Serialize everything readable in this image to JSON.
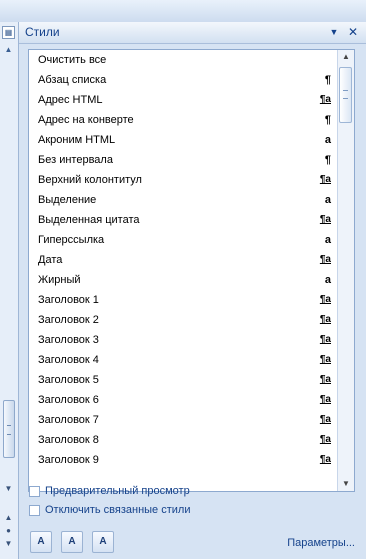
{
  "pane": {
    "title": "Стили",
    "dropdown_icon": "▼",
    "close_icon": "✕"
  },
  "styles": [
    {
      "name": "Очистить все",
      "glyph": "",
      "type": "none"
    },
    {
      "name": "Абзац списка",
      "glyph": "¶",
      "type": "paragraph"
    },
    {
      "name": "Адрес HTML",
      "glyph": "¶a",
      "type": "linked"
    },
    {
      "name": "Адрес на конверте",
      "glyph": "¶",
      "type": "paragraph"
    },
    {
      "name": "Акроним HTML",
      "glyph": "a",
      "type": "character"
    },
    {
      "name": "Без интервала",
      "glyph": "¶",
      "type": "paragraph"
    },
    {
      "name": "Верхний колонтитул",
      "glyph": "¶a",
      "type": "linked"
    },
    {
      "name": "Выделение",
      "glyph": "a",
      "type": "character"
    },
    {
      "name": "Выделенная цитата",
      "glyph": "¶a",
      "type": "linked"
    },
    {
      "name": "Гиперссылка",
      "glyph": "a",
      "type": "character"
    },
    {
      "name": "Дата",
      "glyph": "¶a",
      "type": "linked"
    },
    {
      "name": "Жирный",
      "glyph": "a",
      "type": "character"
    },
    {
      "name": "Заголовок 1",
      "glyph": "¶a",
      "type": "linked"
    },
    {
      "name": "Заголовок 2",
      "glyph": "¶a",
      "type": "linked"
    },
    {
      "name": "Заголовок 3",
      "glyph": "¶a",
      "type": "linked"
    },
    {
      "name": "Заголовок 4",
      "glyph": "¶a",
      "type": "linked"
    },
    {
      "name": "Заголовок 5",
      "glyph": "¶a",
      "type": "linked"
    },
    {
      "name": "Заголовок 6",
      "glyph": "¶a",
      "type": "linked"
    },
    {
      "name": "Заголовок 7",
      "glyph": "¶a",
      "type": "linked"
    },
    {
      "name": "Заголовок 8",
      "glyph": "¶a",
      "type": "linked"
    },
    {
      "name": "Заголовок 9",
      "glyph": "¶a",
      "type": "linked"
    }
  ],
  "options": {
    "preview_label": "Предварительный просмотр",
    "disable_linked_label": "Отключить связанные стили"
  },
  "footer": {
    "new_style_icon": "A",
    "inspector_icon": "A",
    "manage_styles_icon": "A",
    "parameters_label": "Параметры..."
  },
  "colors": {
    "accent": "#15428b",
    "panel_bg": "#d6e3f3"
  }
}
